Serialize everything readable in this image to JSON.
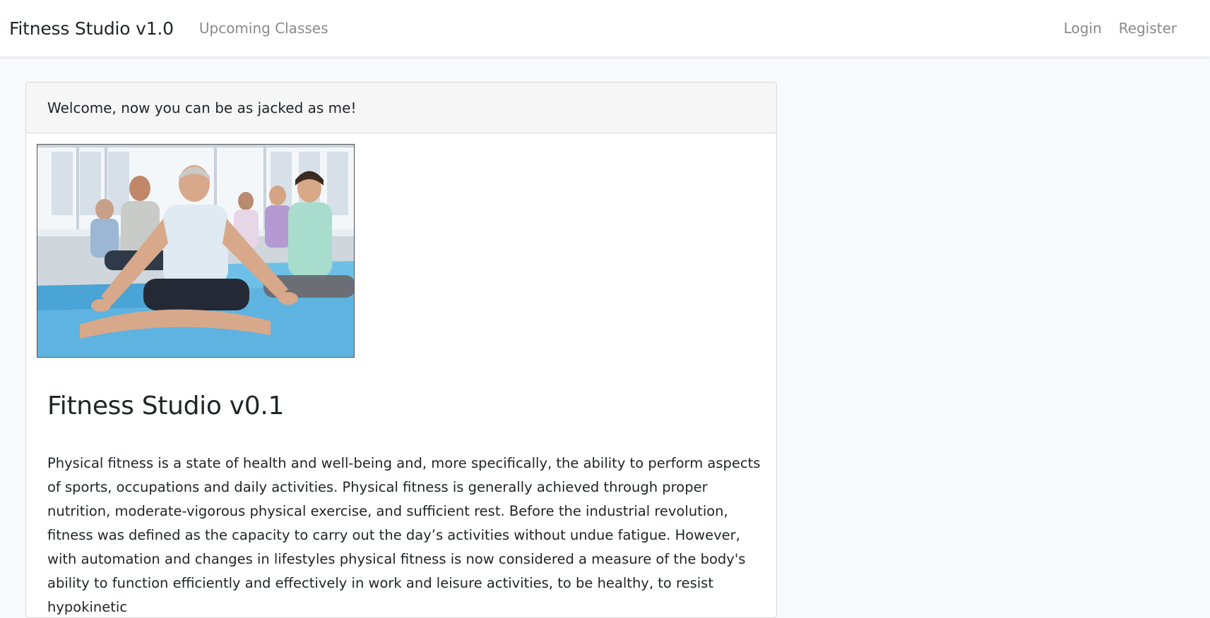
{
  "navbar": {
    "brand": "Fitness Studio v1.0",
    "upcoming_classes": "Upcoming Classes",
    "login": "Login",
    "register": "Register"
  },
  "card": {
    "header": "Welcome, now you can be as jacked as me!",
    "image_alt": "Group of people meditating on yoga mats",
    "title": "Fitness Studio v0.1",
    "text": "Physical fitness is a state of health and well-being and, more specifically, the ability to perform aspects of sports, occupations and daily activities. Physical fitness is generally achieved through proper nutrition, moderate-vigorous physical exercise, and sufficient rest. Before the industrial revolution, fitness was defined as the capacity to carry out the day’s activities without undue fatigue. However, with automation and changes in lifestyles physical fitness is now considered a measure of the body's ability to function efficiently and effectively in work and leisure activities, to be healthy, to resist hypokinetic"
  },
  "colors": {
    "page_bg": "#f8f9fa",
    "nav_link": "#8a8a8a",
    "mat_blue": "#5fb3e0"
  }
}
